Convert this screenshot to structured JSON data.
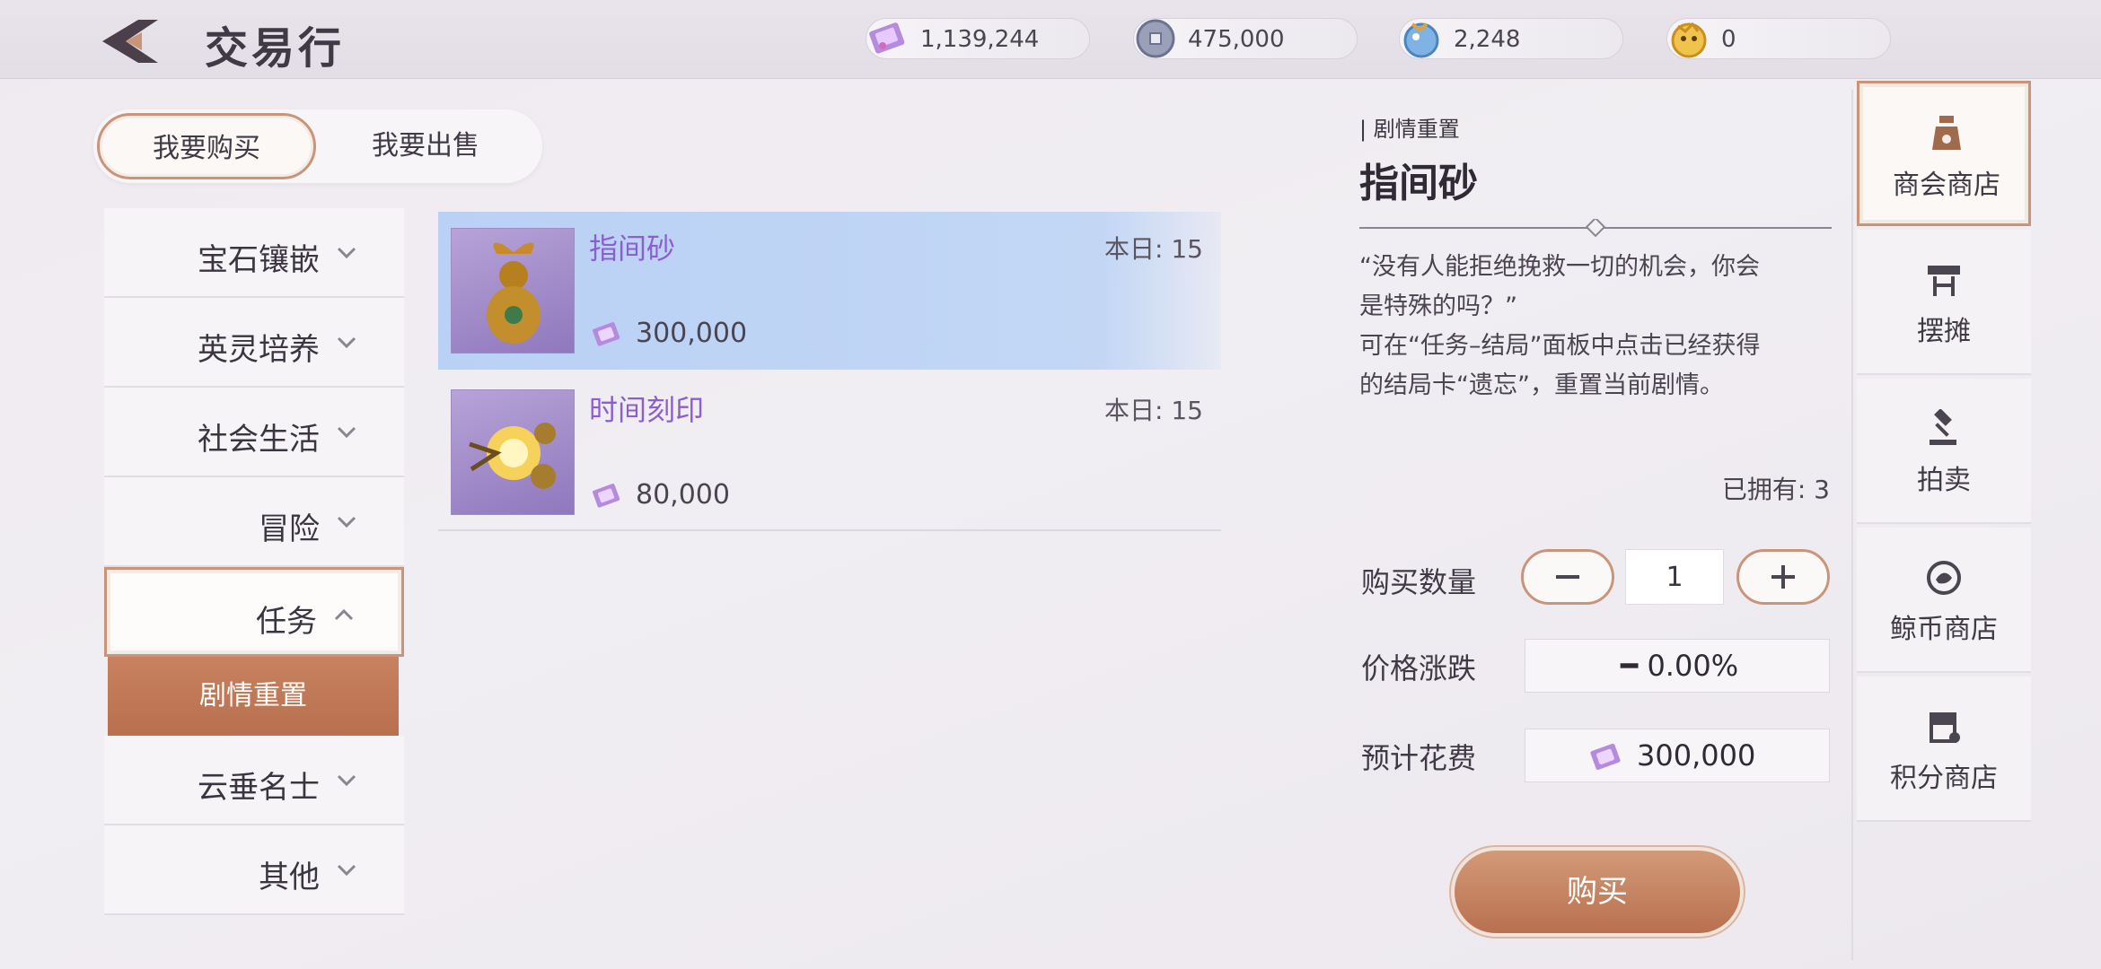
{
  "header": {
    "title": "交易行",
    "currencies": [
      {
        "icon": "ticket-icon",
        "value": "1,139,244"
      },
      {
        "icon": "silver-coin-icon",
        "value": "475,000"
      },
      {
        "icon": "blue-spirit-coin-icon",
        "value": "2,248"
      },
      {
        "icon": "gold-coin-icon",
        "value": "0"
      }
    ]
  },
  "mode": {
    "buy_label": "我要购买",
    "sell_label": "我要出售",
    "active": "buy"
  },
  "categories": [
    {
      "label": "宝石镶嵌",
      "expanded": false
    },
    {
      "label": "英灵培养",
      "expanded": false
    },
    {
      "label": "社会生活",
      "expanded": false
    },
    {
      "label": "冒险",
      "expanded": false
    },
    {
      "label": "任务",
      "expanded": true
    },
    {
      "label": "云垂名士",
      "expanded": false
    },
    {
      "label": "其他",
      "expanded": false
    }
  ],
  "subcategory": {
    "label": "剧情重置",
    "selected": true
  },
  "items": [
    {
      "name": "指间砂",
      "daily": "本日: 15",
      "price": "300,000",
      "selected": true
    },
    {
      "name": "时间刻印",
      "daily": "本日: 15",
      "price": "80,000",
      "selected": false
    }
  ],
  "detail": {
    "category": "| 剧情重置",
    "title": "指间砂",
    "description_lines": [
      "“没有人能拒绝挽救一切的机会，你会",
      "是特殊的吗？”",
      "可在“任务–结局”面板中点击已经获得",
      "的结局卡“遗忘”，重置当前剧情。"
    ],
    "owned": "已拥有: 3",
    "quantity_label": "购买数量",
    "quantity": "1",
    "price_change_label": "价格涨跌",
    "price_change": "━ 0.00%",
    "cost_label": "预计花费",
    "cost": "300,000",
    "buy_label": "购买"
  },
  "right_nav": [
    {
      "label": "商会商店",
      "icon": "money-bag-icon",
      "active": true
    },
    {
      "label": "摆摊",
      "icon": "stall-icon",
      "active": false
    },
    {
      "label": "拍卖",
      "icon": "gavel-icon",
      "active": false
    },
    {
      "label": "鲸币商店",
      "icon": "whale-coin-icon",
      "active": false
    },
    {
      "label": "积分商店",
      "icon": "points-shop-icon",
      "active": false
    }
  ],
  "colors": {
    "accent": "#c9957a",
    "buy_button": "#c07a58",
    "item_name": "#8c5fd0",
    "selected_row": "#bcd3f5"
  }
}
